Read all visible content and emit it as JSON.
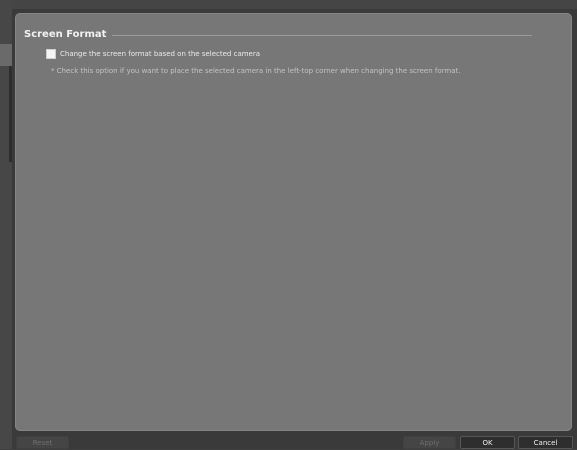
{
  "section": {
    "title": "Screen Format"
  },
  "option": {
    "checked": false,
    "label": "Change the screen format based on the selected camera",
    "hint": "* Check this option if you want to place the selected camera in the left-top corner when changing the screen format."
  },
  "footer": {
    "reset_label": "Reset",
    "apply_label": "Apply",
    "ok_label": "OK",
    "cancel_label": "Cancel"
  }
}
